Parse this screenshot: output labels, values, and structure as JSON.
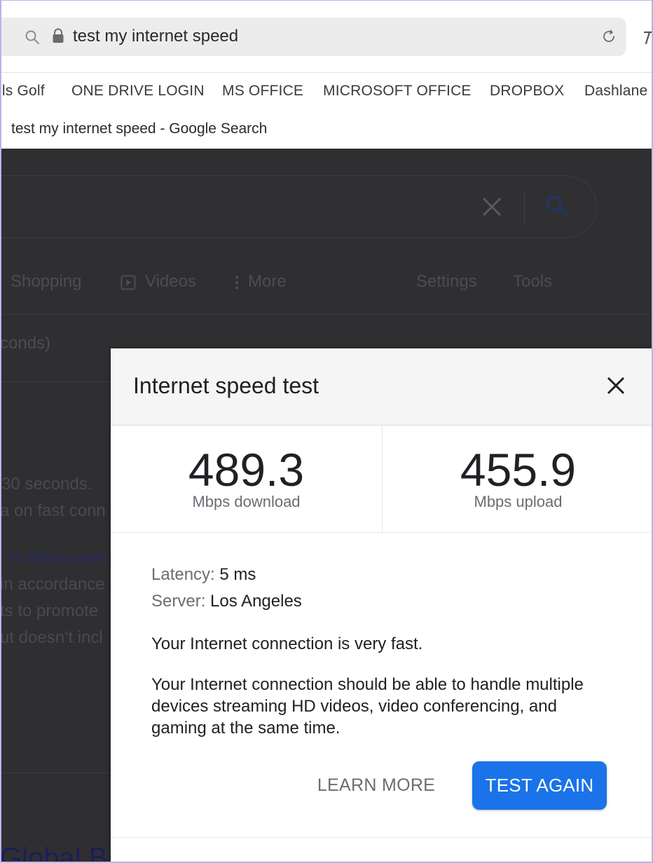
{
  "browser": {
    "address": "test my internet speed",
    "bookmarks": [
      "lls Golf",
      "ONE DRIVE LOGIN",
      "MS OFFICE",
      "MICROSOFT OFFICE",
      "DROPBOX",
      "Dashlane"
    ],
    "tab_title": "test my internet speed - Google Search"
  },
  "google": {
    "tabs": {
      "shopping": "Shopping",
      "videos": "Videos",
      "more": "More",
      "settings": "Settings",
      "tools": "Tools"
    },
    "results_stats": "conds)",
    "snippets": [
      "30 seconds.",
      "a on fast conn",
      "to Measurem",
      "in accordance",
      "ts to promote",
      "ut doesn’t incl"
    ],
    "bottom_link": "Global B"
  },
  "dialog": {
    "title": "Internet speed test",
    "download": {
      "value": "489.3",
      "label": "Mbps download"
    },
    "upload": {
      "value": "455.9",
      "label": "Mbps upload"
    },
    "latency": {
      "label": "Latency:",
      "value": "5 ms"
    },
    "server": {
      "label": "Server:",
      "value": "Los Angeles"
    },
    "summary": "Your Internet connection is very fast.",
    "detail": "Your Internet connection should be able to handle multiple devices streaming HD videos, video conferencing, and gaming at the same time.",
    "learn_more": "LEARN MORE",
    "test_again": "TEST AGAIN"
  },
  "colors": {
    "accent": "#1a73e8",
    "overlay": "#2f2f31"
  }
}
